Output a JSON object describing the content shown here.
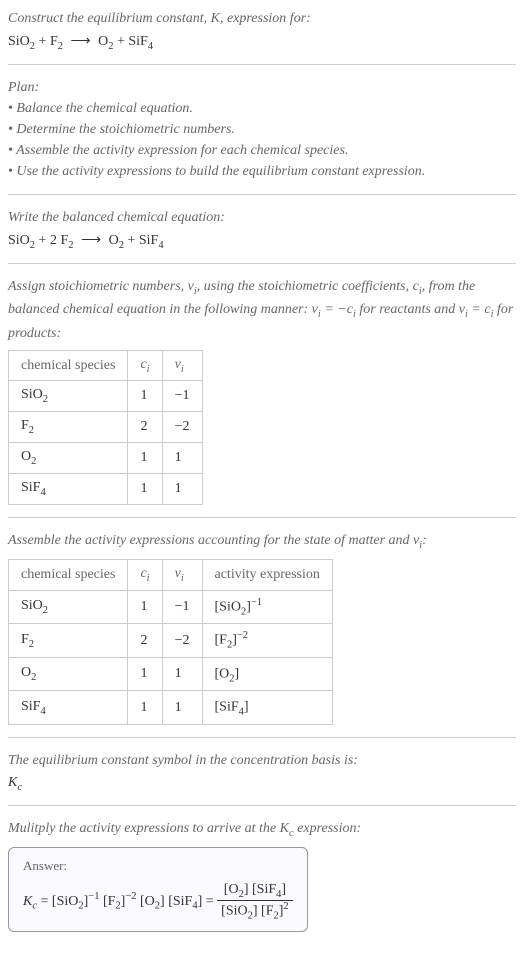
{
  "header": {
    "prompt": "Construct the equilibrium constant, K, expression for:",
    "eq_lhs1": "SiO",
    "eq_lhs1_sub": "2",
    "plus1": " + ",
    "eq_lhs2": "F",
    "eq_lhs2_sub": "2",
    "arrow": "⟶",
    "eq_rhs1": "O",
    "eq_rhs1_sub": "2",
    "plus2": " + ",
    "eq_rhs2": "SiF",
    "eq_rhs2_sub": "4"
  },
  "plan": {
    "title": "Plan:",
    "items": [
      "Balance the chemical equation.",
      "Determine the stoichiometric numbers.",
      "Assemble the activity expression for each chemical species.",
      "Use the activity expressions to build the equilibrium constant expression."
    ]
  },
  "balanced": {
    "prompt": "Write the balanced chemical equation:",
    "lhs1": "SiO",
    "lhs1_sub": "2",
    "plus1": " + 2 ",
    "lhs2": "F",
    "lhs2_sub": "2",
    "arrow": "⟶",
    "rhs1": "O",
    "rhs1_sub": "2",
    "plus2": " + ",
    "rhs2": "SiF",
    "rhs2_sub": "4"
  },
  "stoich": {
    "prompt_part1": "Assign stoichiometric numbers, ",
    "nu_i": "ν",
    "nu_i_sub": "i",
    "prompt_part2": ", using the stoichiometric coefficients, ",
    "c_i": "c",
    "c_i_sub": "i",
    "prompt_part3": ", from the balanced chemical equation in the following manner: ",
    "rel1": "ν",
    "rel1_sub": "i",
    "rel1_eq": " = −",
    "rel1_c": "c",
    "rel1_csub": "i",
    "prompt_part4": " for reactants and ",
    "rel2": "ν",
    "rel2_sub": "i",
    "rel2_eq": " = ",
    "rel2_c": "c",
    "rel2_csub": "i",
    "prompt_part5": " for products:",
    "headers": {
      "species": "chemical species",
      "ci": "c",
      "ci_sub": "i",
      "nui": "ν",
      "nui_sub": "i"
    },
    "rows": [
      {
        "sp": "SiO",
        "sp_sub": "2",
        "ci": "1",
        "nui": "−1"
      },
      {
        "sp": "F",
        "sp_sub": "2",
        "ci": "2",
        "nui": "−2"
      },
      {
        "sp": "O",
        "sp_sub": "2",
        "ci": "1",
        "nui": "1"
      },
      {
        "sp": "SiF",
        "sp_sub": "4",
        "ci": "1",
        "nui": "1"
      }
    ]
  },
  "activity": {
    "prompt_part1": "Assemble the activity expressions accounting for the state of matter and ",
    "nu": "ν",
    "nu_sub": "i",
    "prompt_part2": ":",
    "headers": {
      "species": "chemical species",
      "ci": "c",
      "ci_sub": "i",
      "nui": "ν",
      "nui_sub": "i",
      "ae": "activity expression"
    },
    "rows": [
      {
        "sp": "SiO",
        "sp_sub": "2",
        "ci": "1",
        "nui": "−1",
        "ae_base": "[SiO",
        "ae_sub": "2",
        "ae_close": "]",
        "ae_exp": "−1"
      },
      {
        "sp": "F",
        "sp_sub": "2",
        "ci": "2",
        "nui": "−2",
        "ae_base": "[F",
        "ae_sub": "2",
        "ae_close": "]",
        "ae_exp": "−2"
      },
      {
        "sp": "O",
        "sp_sub": "2",
        "ci": "1",
        "nui": "1",
        "ae_base": "[O",
        "ae_sub": "2",
        "ae_close": "]",
        "ae_exp": ""
      },
      {
        "sp": "SiF",
        "sp_sub": "4",
        "ci": "1",
        "nui": "1",
        "ae_base": "[SiF",
        "ae_sub": "4",
        "ae_close": "]",
        "ae_exp": ""
      }
    ]
  },
  "kc_symbol": {
    "prompt": "The equilibrium constant symbol in the concentration basis is:",
    "K": "K",
    "K_sub": "c"
  },
  "final": {
    "prompt_part1": "Mulitply the activity expressions to arrive at the ",
    "K": "K",
    "K_sub": "c",
    "prompt_part2": " expression:",
    "answer_label": "Answer:",
    "kc": "K",
    "kc_sub": "c",
    "eq": " = ",
    "t1": "[SiO",
    "t1_sub": "2",
    "t1_close": "]",
    "t1_exp": "−1",
    "t2": "[F",
    "t2_sub": "2",
    "t2_close": "]",
    "t2_exp": "−2",
    "t3": "[O",
    "t3_sub": "2",
    "t3_close": "]",
    "t4": "[SiF",
    "t4_sub": "4",
    "t4_close": "]",
    "eq2": " = ",
    "num1": "[O",
    "num1_sub": "2",
    "num1_close": "] ",
    "num2": "[SiF",
    "num2_sub": "4",
    "num2_close": "]",
    "den1": "[SiO",
    "den1_sub": "2",
    "den1_close": "] ",
    "den2": "[F",
    "den2_sub": "2",
    "den2_close": "]",
    "den2_exp": "2"
  }
}
